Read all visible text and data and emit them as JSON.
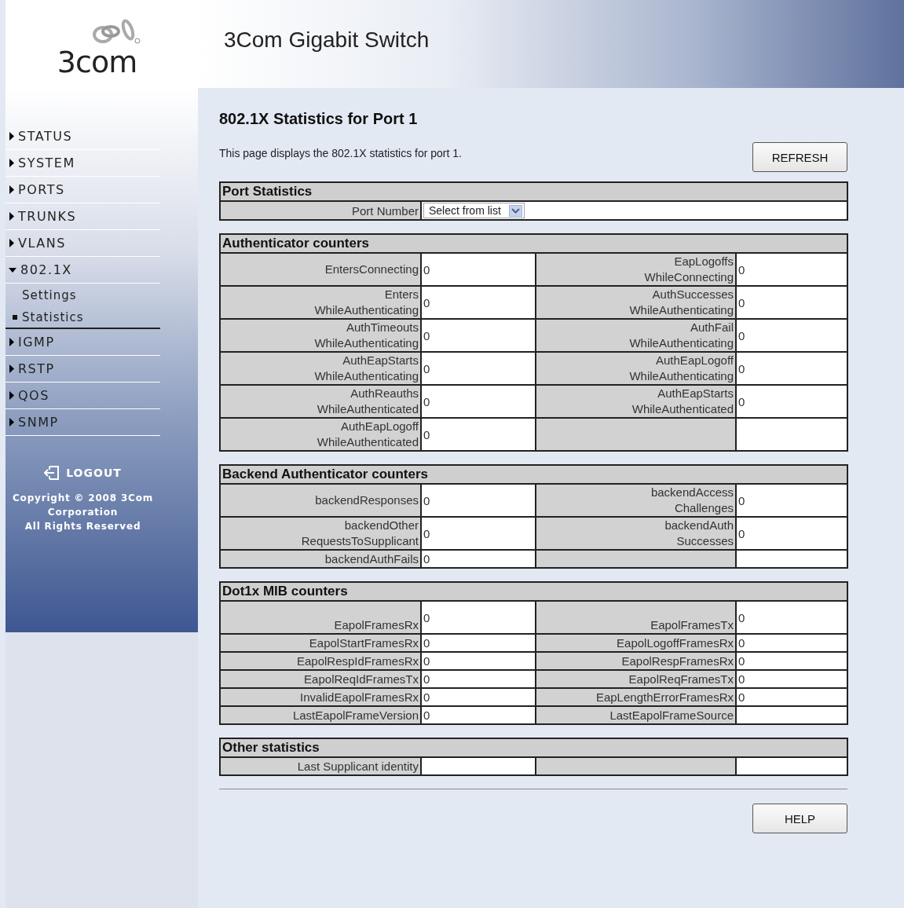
{
  "logo": {
    "text": "3com"
  },
  "header": {
    "title": "3Com Gigabit Switch"
  },
  "nav": [
    {
      "label": "STATUS",
      "expanded": false
    },
    {
      "label": "SYSTEM",
      "expanded": false
    },
    {
      "label": "PORTS",
      "expanded": false
    },
    {
      "label": "TRUNKS",
      "expanded": false
    },
    {
      "label": "VLANS",
      "expanded": false
    },
    {
      "label": "802.1X",
      "expanded": true,
      "children": [
        {
          "label": "Settings",
          "selected": false
        },
        {
          "label": "Statistics",
          "selected": true
        }
      ]
    },
    {
      "label": "IGMP",
      "expanded": false
    },
    {
      "label": "RSTP",
      "expanded": false
    },
    {
      "label": "QOS",
      "expanded": false
    },
    {
      "label": "SNMP",
      "expanded": false
    }
  ],
  "logout": "LOGOUT",
  "copyright": "Copyright © 2008 3Com\nCorporation\nAll Rights Reserved",
  "page": {
    "heading": "802.1X Statistics for Port 1",
    "description": "This page displays the 802.1X statistics for port 1.",
    "refresh": "REFRESH",
    "help": "HELP"
  },
  "sections": [
    {
      "kind": "select",
      "title": "Port Statistics",
      "label": "Port Number",
      "select": "Select from list"
    },
    {
      "kind": "counters",
      "title": "Authenticator counters",
      "rows": [
        [
          {
            "label": "EntersConnecting",
            "value": "0"
          },
          {
            "label": "EapLogoffs\nWhileConnecting",
            "value": "0"
          }
        ],
        [
          {
            "label": "Enters\nWhileAuthenticating",
            "value": "0"
          },
          {
            "label": "AuthSuccesses\nWhileAuthenticating",
            "value": "0"
          }
        ],
        [
          {
            "label": "AuthTimeouts\nWhileAuthenticating",
            "value": "0"
          },
          {
            "label": "AuthFail\nWhileAuthenticating",
            "value": "0"
          }
        ],
        [
          {
            "label": "AuthEapStarts\nWhileAuthenticating",
            "value": "0"
          },
          {
            "label": "AuthEapLogoff\nWhileAuthenticating",
            "value": "0"
          }
        ],
        [
          {
            "label": "AuthReauths\nWhileAuthenticated",
            "value": "0"
          },
          {
            "label": "AuthEapStarts\nWhileAuthenticated",
            "value": "0"
          }
        ],
        [
          {
            "label": "AuthEapLogoff\nWhileAuthenticated",
            "value": "0"
          },
          {}
        ]
      ]
    },
    {
      "kind": "counters",
      "title": "Backend Authenticator counters",
      "rows": [
        [
          {
            "label": "backendResponses",
            "value": "0"
          },
          {
            "label": "backendAccess\nChallenges",
            "value": "0"
          }
        ],
        [
          {
            "label": "backendOther\nRequestsToSupplicant",
            "value": "0"
          },
          {
            "label": "backendAuth\nSuccesses",
            "value": "0"
          }
        ],
        [
          {
            "label": "backendAuthFails",
            "value": "0"
          },
          {}
        ]
      ]
    },
    {
      "kind": "counters",
      "title": "Dot1x MIB counters",
      "rows": [
        [
          {
            "label": "EapolFramesRx",
            "value": "0"
          },
          {
            "label": "EapolFramesTx",
            "value": "0"
          }
        ],
        [
          {
            "label": "EapolStartFramesRx",
            "value": "0"
          },
          {
            "label": "EapolLogoffFramesRx",
            "value": "0"
          }
        ],
        [
          {
            "label": "EapolRespIdFramesRx",
            "value": "0"
          },
          {
            "label": "EapolRespFramesRx",
            "value": "0"
          }
        ],
        [
          {
            "label": "EapolReqIdFramesTx",
            "value": "0"
          },
          {
            "label": "EapolReqFramesTx",
            "value": "0"
          }
        ],
        [
          {
            "label": "InvalidEapolFramesRx",
            "value": "0"
          },
          {
            "label": "EapLengthErrorFramesRx",
            "value": "0"
          }
        ],
        [
          {
            "label": "LastEapolFrameVersion",
            "value": "0"
          },
          {
            "label": "LastEapolFrameSource"
          }
        ]
      ]
    },
    {
      "kind": "counters",
      "title": "Other statistics",
      "rows": [
        [
          {
            "label": "Last Supplicant identity"
          },
          {}
        ]
      ]
    }
  ]
}
